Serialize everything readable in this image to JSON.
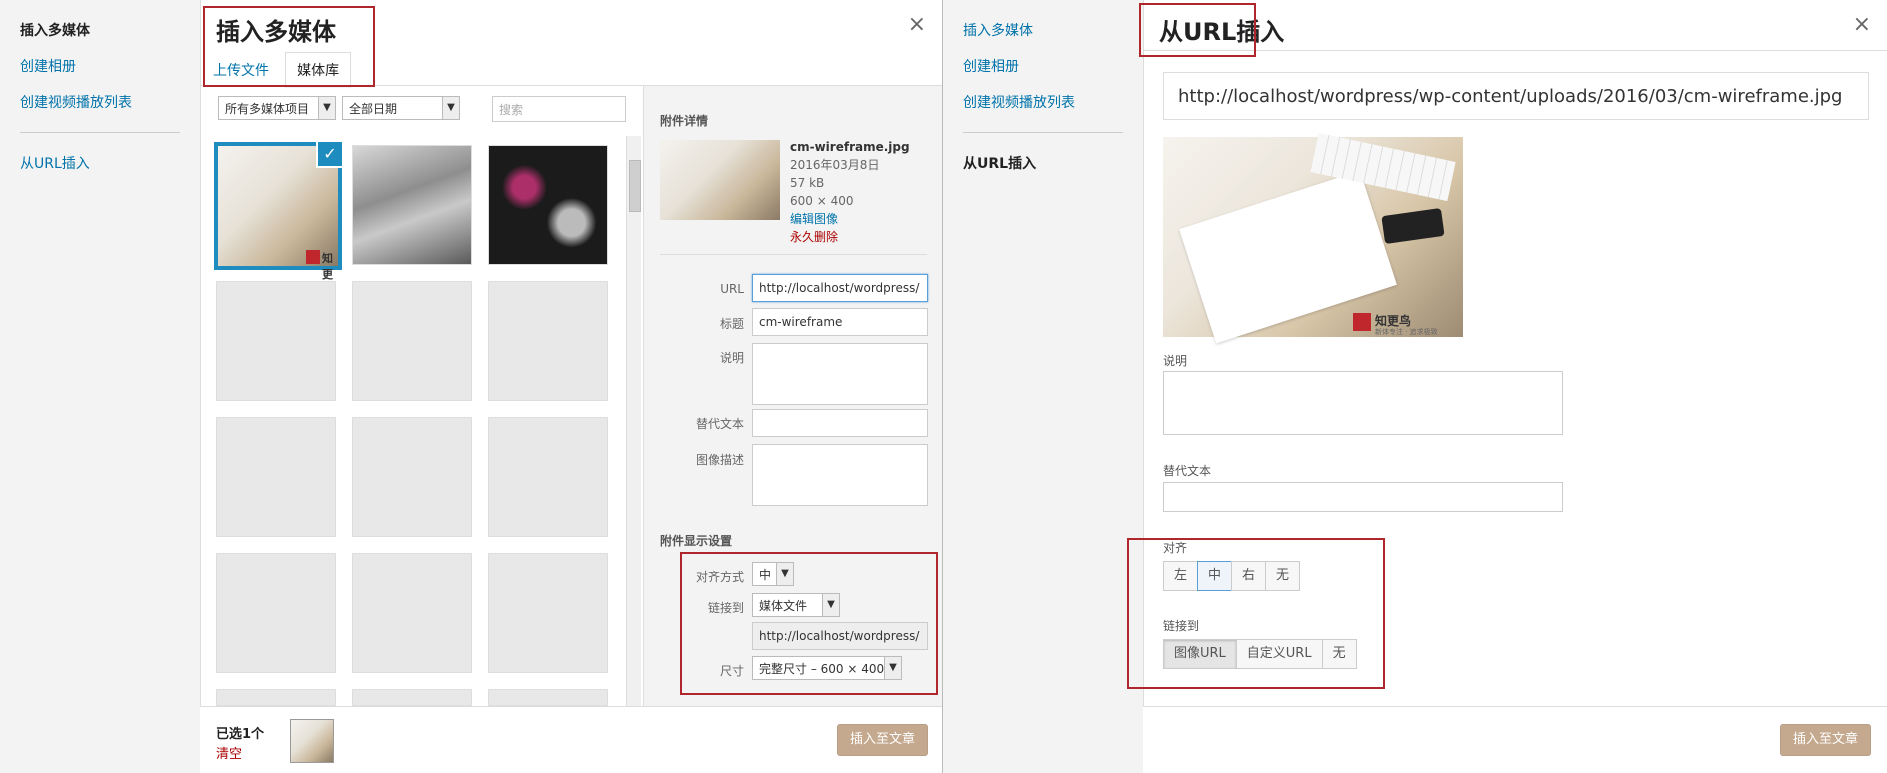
{
  "left": {
    "sidebar": {
      "items": [
        {
          "label": "插入多媒体",
          "active": true
        },
        {
          "label": "创建相册"
        },
        {
          "label": "创建视频播放列表"
        },
        {
          "label": "从URL插入"
        }
      ]
    },
    "title": "插入多媒体",
    "close": "×",
    "tabs": [
      {
        "label": "上传文件"
      },
      {
        "label": "媒体库",
        "active": true
      }
    ],
    "filters": {
      "type": "所有多媒体项目",
      "date": "全部日期",
      "search_placeholder": "搜索"
    },
    "details": {
      "heading": "附件详情",
      "filename": "cm-wireframe.jpg",
      "date": "2016年03月8日",
      "size": "57 kB",
      "dimensions": "600 × 400",
      "edit_link": "编辑图像",
      "delete_link": "永久删除",
      "fields": {
        "url_label": "URL",
        "url_value": "http://localhost/wordpress/",
        "title_label": "标题",
        "title_value": "cm-wireframe",
        "caption_label": "说明",
        "alt_label": "替代文本",
        "desc_label": "图像描述"
      },
      "display": {
        "heading": "附件显示设置",
        "align_label": "对齐方式",
        "align_value": "中",
        "link_label": "链接到",
        "link_value": "媒体文件",
        "link_url": "http://localhost/wordpress/",
        "size_label": "尺寸",
        "size_value": "完整尺寸 – 600 × 400"
      }
    },
    "footer": {
      "selected": "已选1个",
      "clear": "清空",
      "insert": "插入至文章"
    },
    "watermark": "知更"
  },
  "right": {
    "sidebar": {
      "items": [
        {
          "label": "插入多媒体"
        },
        {
          "label": "创建相册"
        },
        {
          "label": "创建视频播放列表"
        },
        {
          "label": "从URL插入",
          "active": true
        }
      ]
    },
    "title": "从URL插入",
    "close": "×",
    "url": "http://localhost/wordpress/wp-content/uploads/2016/03/cm-wireframe.jpg",
    "caption_label": "说明",
    "alt_label": "替代文本",
    "align_label": "对齐",
    "align_options": [
      "左",
      "中",
      "右",
      "无"
    ],
    "align_selected": "中",
    "link_label": "链接到",
    "link_options": [
      "图像URL",
      "自定义URL",
      "无"
    ],
    "link_selected": "图像URL",
    "insert": "插入至文章",
    "watermark": "知更鸟",
    "watermark_sub": "新体专注 · 追求极致"
  },
  "colors": {
    "accent": "#0073aa",
    "selection_border": "#1e8cbe",
    "highlight_box": "#b0262d",
    "insert_button": "#c4a98e"
  }
}
